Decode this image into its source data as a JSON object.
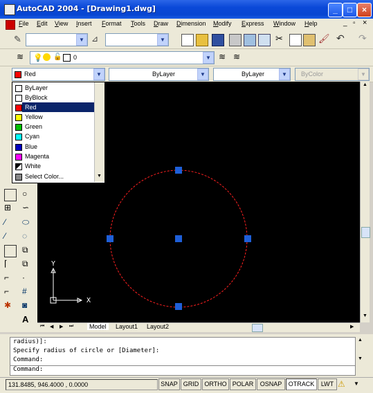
{
  "window": {
    "title": "AutoCAD 2004 - [Drawing1.dwg]"
  },
  "menubar": [
    "File",
    "Edit",
    "View",
    "Insert",
    "Format",
    "Tools",
    "Draw",
    "Dimension",
    "Modify",
    "Express",
    "Window",
    "Help"
  ],
  "layer": {
    "name": "0"
  },
  "properties": {
    "color": "Red",
    "linetype": "ByLayer",
    "lineweight": "ByLayer",
    "plotstyle": "ByColor"
  },
  "color_dropdown": {
    "items": [
      {
        "label": "ByLayer",
        "color": "#ffffff"
      },
      {
        "label": "ByBlock",
        "color": "#ffffff"
      },
      {
        "label": "Red",
        "color": "#ff0000",
        "selected": true
      },
      {
        "label": "Yellow",
        "color": "#ffff00"
      },
      {
        "label": "Green",
        "color": "#00c000"
      },
      {
        "label": "Cyan",
        "color": "#00ffff"
      },
      {
        "label": "Blue",
        "color": "#0000c0"
      },
      {
        "label": "Magenta",
        "color": "#ff00ff"
      },
      {
        "label": "White",
        "color": "#000000"
      },
      {
        "label": "Select Color...",
        "color": "#808080"
      }
    ]
  },
  "ucs": {
    "x_label": "X",
    "y_label": "Y"
  },
  "tabs": [
    "Model",
    "Layout1",
    "Layout2"
  ],
  "command": {
    "history": [
      "radius)]:",
      "Specify radius of circle or [Diameter]:",
      "Command:"
    ],
    "prompt": "Command:"
  },
  "status": {
    "coords": "131.8485, 946.4000 , 0.0000",
    "toggles": [
      "SNAP",
      "GRID",
      "ORTHO",
      "POLAR",
      "OSNAP",
      "OTRACK",
      "LWT"
    ]
  },
  "colors": {
    "canvas": "#000000",
    "circle": "#ff0000",
    "grip": "#1e5fd8",
    "titlebar": "#0a48d8"
  }
}
